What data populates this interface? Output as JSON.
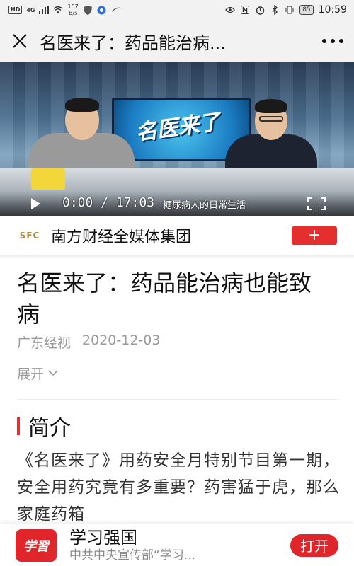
{
  "status_bar": {
    "hd_label": "HD",
    "network_label": "4G",
    "speed_value": "157",
    "speed_unit": "B/s",
    "battery": "85",
    "time": "10:59"
  },
  "title_bar": {
    "title": "名医来了：药品能治病..."
  },
  "video": {
    "screen_logo": "名医来了",
    "subtitle": "糖尿病人的日常生活",
    "time": "0:00 / 17:03"
  },
  "account": {
    "logo_letters": "SFC",
    "name": "南方财经全媒体集团",
    "follow_label": "+"
  },
  "article": {
    "title": "名医来了：药品能治病也能致病",
    "source": "广东经视",
    "date": "2020-12-03",
    "expand_label": "展开",
    "section_title": "简介",
    "intro": "《名医来了》用药安全月特别节目第一期，安全用药究竟有多重要？药害猛于虎，那么家庭药箱"
  },
  "app_banner": {
    "logo_text": "学習",
    "name": "学习强国",
    "description": "中共中央宣传部“学习...",
    "open_label": "打开"
  },
  "colors": {
    "accent_red": "#e52e2e",
    "app_red": "#e0262b"
  }
}
